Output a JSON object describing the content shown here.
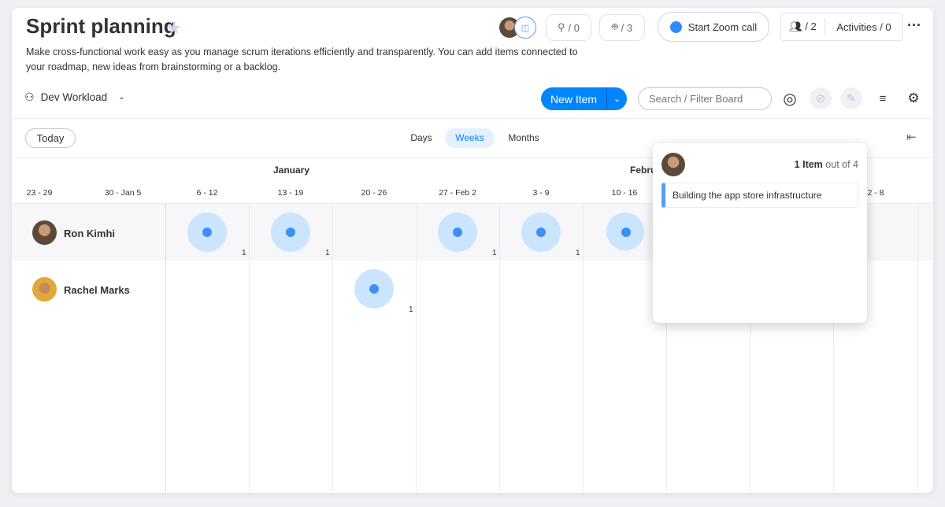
{
  "board": {
    "title": "Sprint planning",
    "description": "Make cross-functional work easy as you manage scrum iterations efficiently and transparently. You can add items connected to your roadmap, new ideas from brainstorming or a backlog."
  },
  "header": {
    "integrations": "/ 0",
    "automations": "/ 3",
    "zoom_call": "Start Zoom call",
    "members": "/ 2",
    "activities": "Activities / 0"
  },
  "toolbar": {
    "view": "Dev Workload",
    "new_item": "New Item",
    "search_placeholder": "Search / Filter Board"
  },
  "timeline": {
    "today": "Today",
    "scales": [
      "Days",
      "Weeks",
      "Months"
    ],
    "active_scale": "Weeks",
    "months": [
      "January",
      "Febru"
    ],
    "weeks": [
      "23 - 29",
      "30 - Jan 5",
      "6 - 12",
      "13 - 19",
      "20 - 26",
      "27 - Feb 2",
      "3 - 9",
      "10 - 16",
      "2 - 8"
    ]
  },
  "people": [
    {
      "name": "Ron Kimhi",
      "counts": [
        "1",
        "1",
        "1",
        "1"
      ]
    },
    {
      "name": "Rachel Marks",
      "counts": [
        "1"
      ]
    }
  ],
  "popup": {
    "count": "1 Item",
    "suffix": "out of 4",
    "item": "Building the app store infrastructure",
    "item_color": "#579bfc"
  },
  "colors": {
    "accent": "#0085ff",
    "bubble": "#cce5ff",
    "dot": "#3d8ff5"
  }
}
